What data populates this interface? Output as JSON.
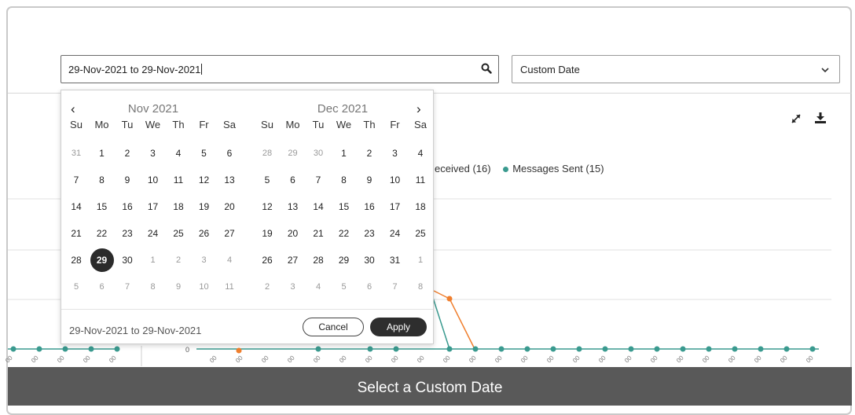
{
  "search": {
    "value": "29-Nov-2021 to 29-Nov-2021"
  },
  "date_select": {
    "selected": "Custom Date"
  },
  "legend": {
    "received_label": "eceived",
    "received_count": "(16)",
    "sent_label": "Messages Sent",
    "sent_count": "(15)"
  },
  "chart_axis": {
    "zero_label": "0"
  },
  "calendar": {
    "prev": "‹",
    "next": "›",
    "months": [
      {
        "title": "Nov 2021",
        "weekdays": [
          "Su",
          "Mo",
          "Tu",
          "We",
          "Th",
          "Fr",
          "Sa"
        ],
        "weeks": [
          [
            "31",
            "1",
            "2",
            "3",
            "4",
            "5",
            "6"
          ],
          [
            "7",
            "8",
            "9",
            "10",
            "11",
            "12",
            "13"
          ],
          [
            "14",
            "15",
            "16",
            "17",
            "18",
            "19",
            "20"
          ],
          [
            "21",
            "22",
            "23",
            "24",
            "25",
            "26",
            "27"
          ],
          [
            "28",
            "29",
            "30",
            "1",
            "2",
            "3",
            "4"
          ],
          [
            "5",
            "6",
            "7",
            "8",
            "9",
            "10",
            "11"
          ]
        ]
      },
      {
        "title": "Dec 2021",
        "weekdays": [
          "Su",
          "Mo",
          "Tu",
          "We",
          "Th",
          "Fr",
          "Sa"
        ],
        "weeks": [
          [
            "28",
            "29",
            "30",
            "1",
            "2",
            "3",
            "4"
          ],
          [
            "5",
            "6",
            "7",
            "8",
            "9",
            "10",
            "11"
          ],
          [
            "12",
            "13",
            "14",
            "15",
            "16",
            "17",
            "18"
          ],
          [
            "19",
            "20",
            "21",
            "22",
            "23",
            "24",
            "25"
          ],
          [
            "26",
            "27",
            "28",
            "29",
            "30",
            "31",
            "1"
          ],
          [
            "2",
            "3",
            "4",
            "5",
            "6",
            "7",
            "8"
          ]
        ]
      }
    ],
    "selected_day": "29",
    "footer_range": "29-Nov-2021 to 29-Nov-2021",
    "cancel_label": "Cancel",
    "apply_label": "Apply"
  },
  "tooltip": "Select a Custom Date",
  "colors": {
    "teal": "#3a9a8f",
    "orange": "#f07f2e",
    "dark": "#2e2e2e"
  }
}
